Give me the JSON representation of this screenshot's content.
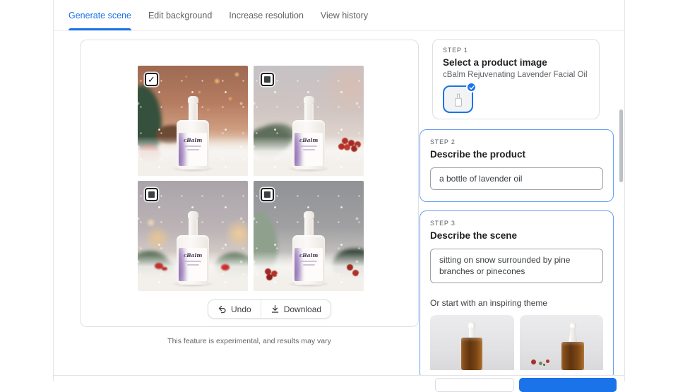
{
  "colors": {
    "accent": "#1a73e8",
    "active_card_border": "#669df6"
  },
  "tabs": [
    {
      "label": "Generate scene",
      "active": true
    },
    {
      "label": "Edit background",
      "active": false
    },
    {
      "label": "Increase resolution",
      "active": false
    },
    {
      "label": "View history",
      "active": false
    }
  ],
  "product": {
    "brand": "cBalm"
  },
  "results": {
    "images": [
      {
        "name": "scene-warm-bokeh",
        "checked": true,
        "alt": "lavender oil bottle on snow with warm orange bokeh lights, pine tree and pinecones"
      },
      {
        "name": "scene-snowfall-berries",
        "checked": false,
        "alt": "lavender oil bottle on snow with snowy pine branch and red berries"
      },
      {
        "name": "scene-warm-glow-bows",
        "checked": false,
        "alt": "lavender oil bottle on snow with warm glowing lights and pine branches with red bows"
      },
      {
        "name": "scene-gray-pines",
        "checked": false,
        "alt": "lavender oil bottle on snow with snowy trees, pine branch and red berries"
      }
    ],
    "undo_label": "Undo",
    "download_label": "Download",
    "experimental_note": "This feature is experimental, and results may vary"
  },
  "steps": {
    "step1": {
      "eyebrow": "STEP 1",
      "title": "Select a product image",
      "product_name": "cBalm Rejuvenating Lavender Facial Oil",
      "thumbnail": {
        "name": "product-image-thumbnail",
        "selected": true
      }
    },
    "step2": {
      "eyebrow": "STEP 2",
      "title": "Describe the product",
      "value": "a bottle of lavender oil"
    },
    "step3": {
      "eyebrow": "STEP 3",
      "title": "Describe the scene",
      "value": "sitting on snow surrounded by pine branches or pinecones",
      "theme_prompt_label": "Or start with an inspiring theme",
      "themes": [
        {
          "name": "theme-amber-dropper-bottle"
        },
        {
          "name": "theme-amber-bottle-with-berries"
        }
      ]
    }
  }
}
